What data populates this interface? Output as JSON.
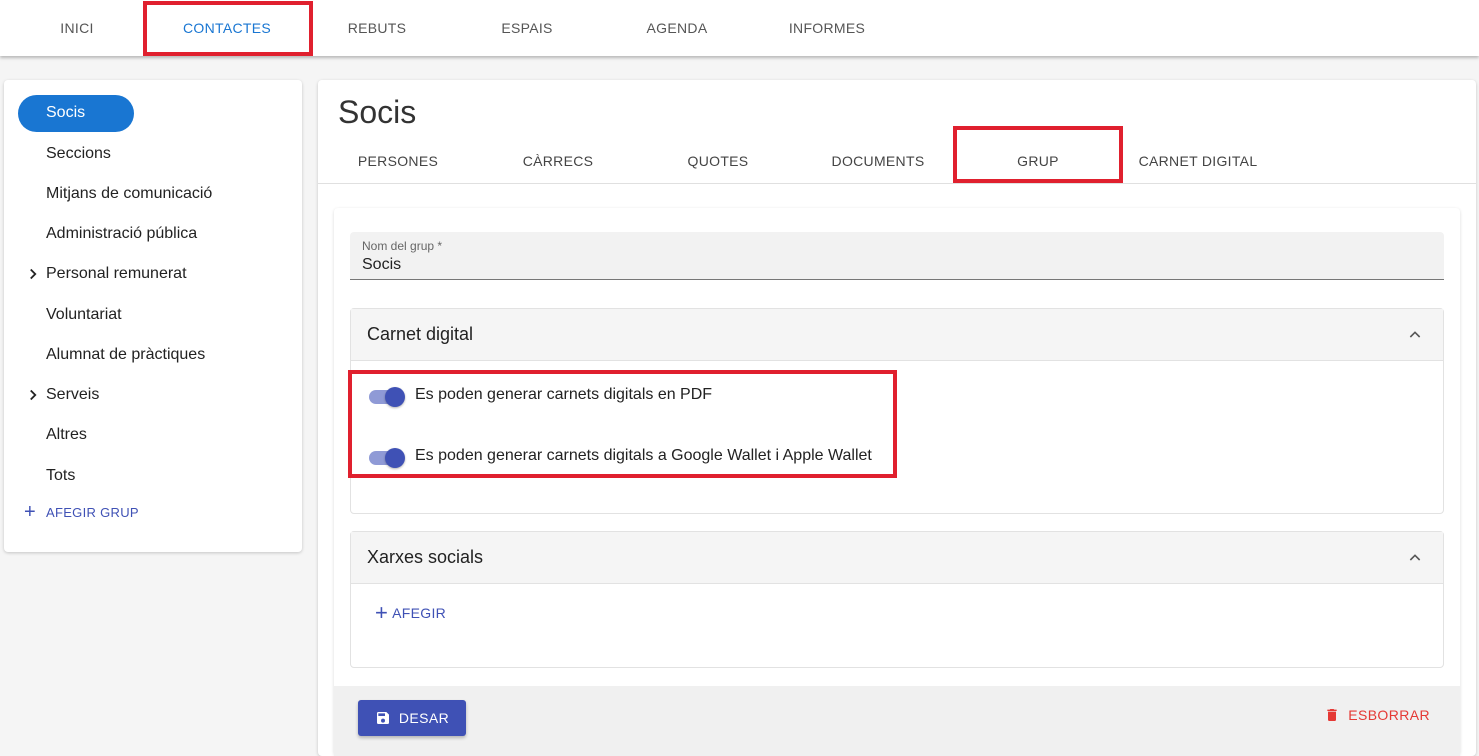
{
  "topnav": {
    "tabs": [
      {
        "label": "INICI"
      },
      {
        "label": "CONTACTES",
        "active": true
      },
      {
        "label": "REBUTS"
      },
      {
        "label": "ESPAIS"
      },
      {
        "label": "AGENDA"
      },
      {
        "label": "INFORMES"
      }
    ]
  },
  "sidebar": {
    "items": [
      {
        "label": "Socis",
        "active": true
      },
      {
        "label": "Seccions"
      },
      {
        "label": "Mitjans de comunicació"
      },
      {
        "label": "Administració pública"
      },
      {
        "label": "Personal remunerat",
        "expandable": true
      },
      {
        "label": "Voluntariat"
      },
      {
        "label": "Alumnat de pràctiques"
      },
      {
        "label": "Serveis",
        "expandable": true
      },
      {
        "label": "Altres"
      },
      {
        "label": "Tots"
      }
    ],
    "add_group_label": "AFEGIR GRUP"
  },
  "main": {
    "title": "Socis",
    "tabs": [
      {
        "label": "PERSONES"
      },
      {
        "label": "CÀRRECS"
      },
      {
        "label": "QUOTES"
      },
      {
        "label": "DOCUMENTS"
      },
      {
        "label": "GRUP",
        "active": true
      },
      {
        "label": "CARNET DIGITAL"
      }
    ],
    "group_name_field": {
      "label": "Nom del grup *",
      "value": "Socis"
    },
    "carnet_panel": {
      "title": "Carnet digital",
      "toggles": [
        {
          "label": "Es poden generar carnets digitals en PDF",
          "on": true
        },
        {
          "label": "Es poden generar carnets digitals a Google Wallet i Apple Wallet",
          "on": true
        }
      ]
    },
    "social_panel": {
      "title": "Xarxes socials",
      "add_label": "AFEGIR"
    },
    "footer": {
      "save_label": "DESAR",
      "delete_label": "ESBORRAR"
    }
  },
  "colors": {
    "accent": "#1976d2",
    "primary": "#3f51b5",
    "danger": "#e53935",
    "highlight": "#e0202e"
  }
}
